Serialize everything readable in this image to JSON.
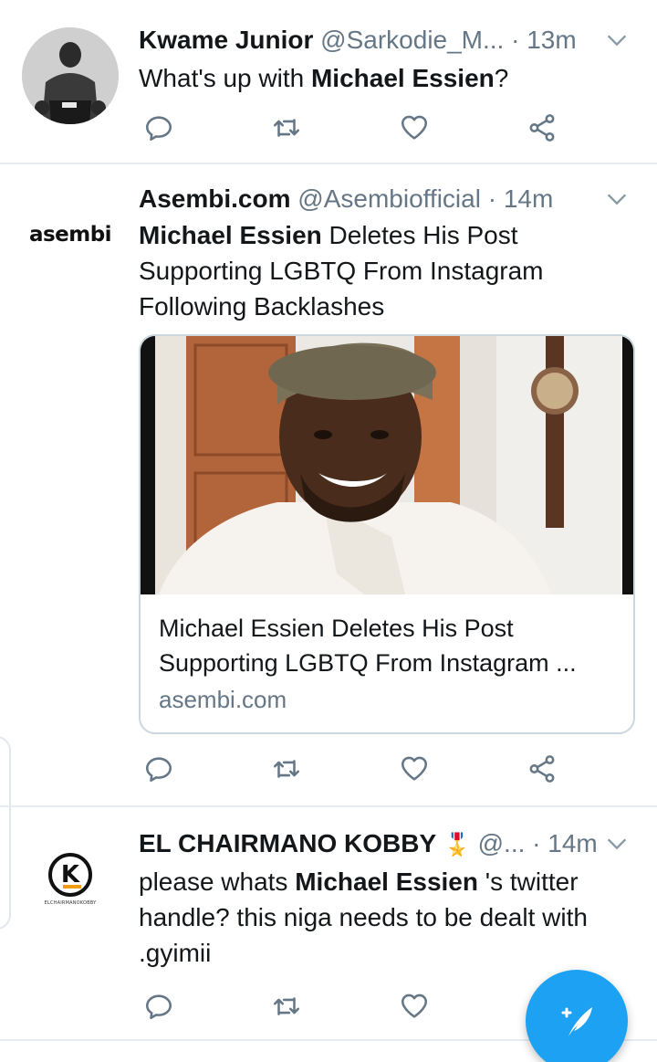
{
  "colors": {
    "accent": "#1da1f2",
    "secondary_text": "#657786",
    "divider": "#e6ecf0"
  },
  "tweets": [
    {
      "display_name": "Kwame Junior",
      "handle": "@Sarkodie_M...",
      "separator": "·",
      "time": "13m",
      "text_plain_1": "What's up with ",
      "text_bold_1": "Michael Essien",
      "text_plain_2": "?"
    },
    {
      "avatar_logo_text": "asembi",
      "display_name": "Asembi.com",
      "handle": "@Asembiofficial",
      "separator": "·",
      "time": "14m",
      "text_bold_1": "Michael Essien",
      "text_plain_1": " Deletes His Post Supporting LGBTQ From Instagram Following Backlashes",
      "card": {
        "title": "Michael Essien Deletes His Post Supporting LGBTQ From Instagram ...",
        "domain": "asembi.com"
      }
    },
    {
      "avatar_logo_letter": "K",
      "avatar_logo_caption": "ELCHAIRMANOKOBBY",
      "display_name": "EL CHAIRMANO KOBBY",
      "badge": "🎖️",
      "handle": "@...",
      "separator": "·",
      "time": "14m",
      "text_plain_1": "please whats ",
      "text_bold_1": "Michael Essien",
      "text_plain_2": " 's twitter handle? this niga needs to be dealt with .gyimii"
    }
  ],
  "icons": {
    "reply": "reply-icon",
    "retweet": "retweet-icon",
    "like": "like-icon",
    "share": "share-icon",
    "caret": "chevron-down-icon",
    "compose": "compose-tweet-icon"
  }
}
